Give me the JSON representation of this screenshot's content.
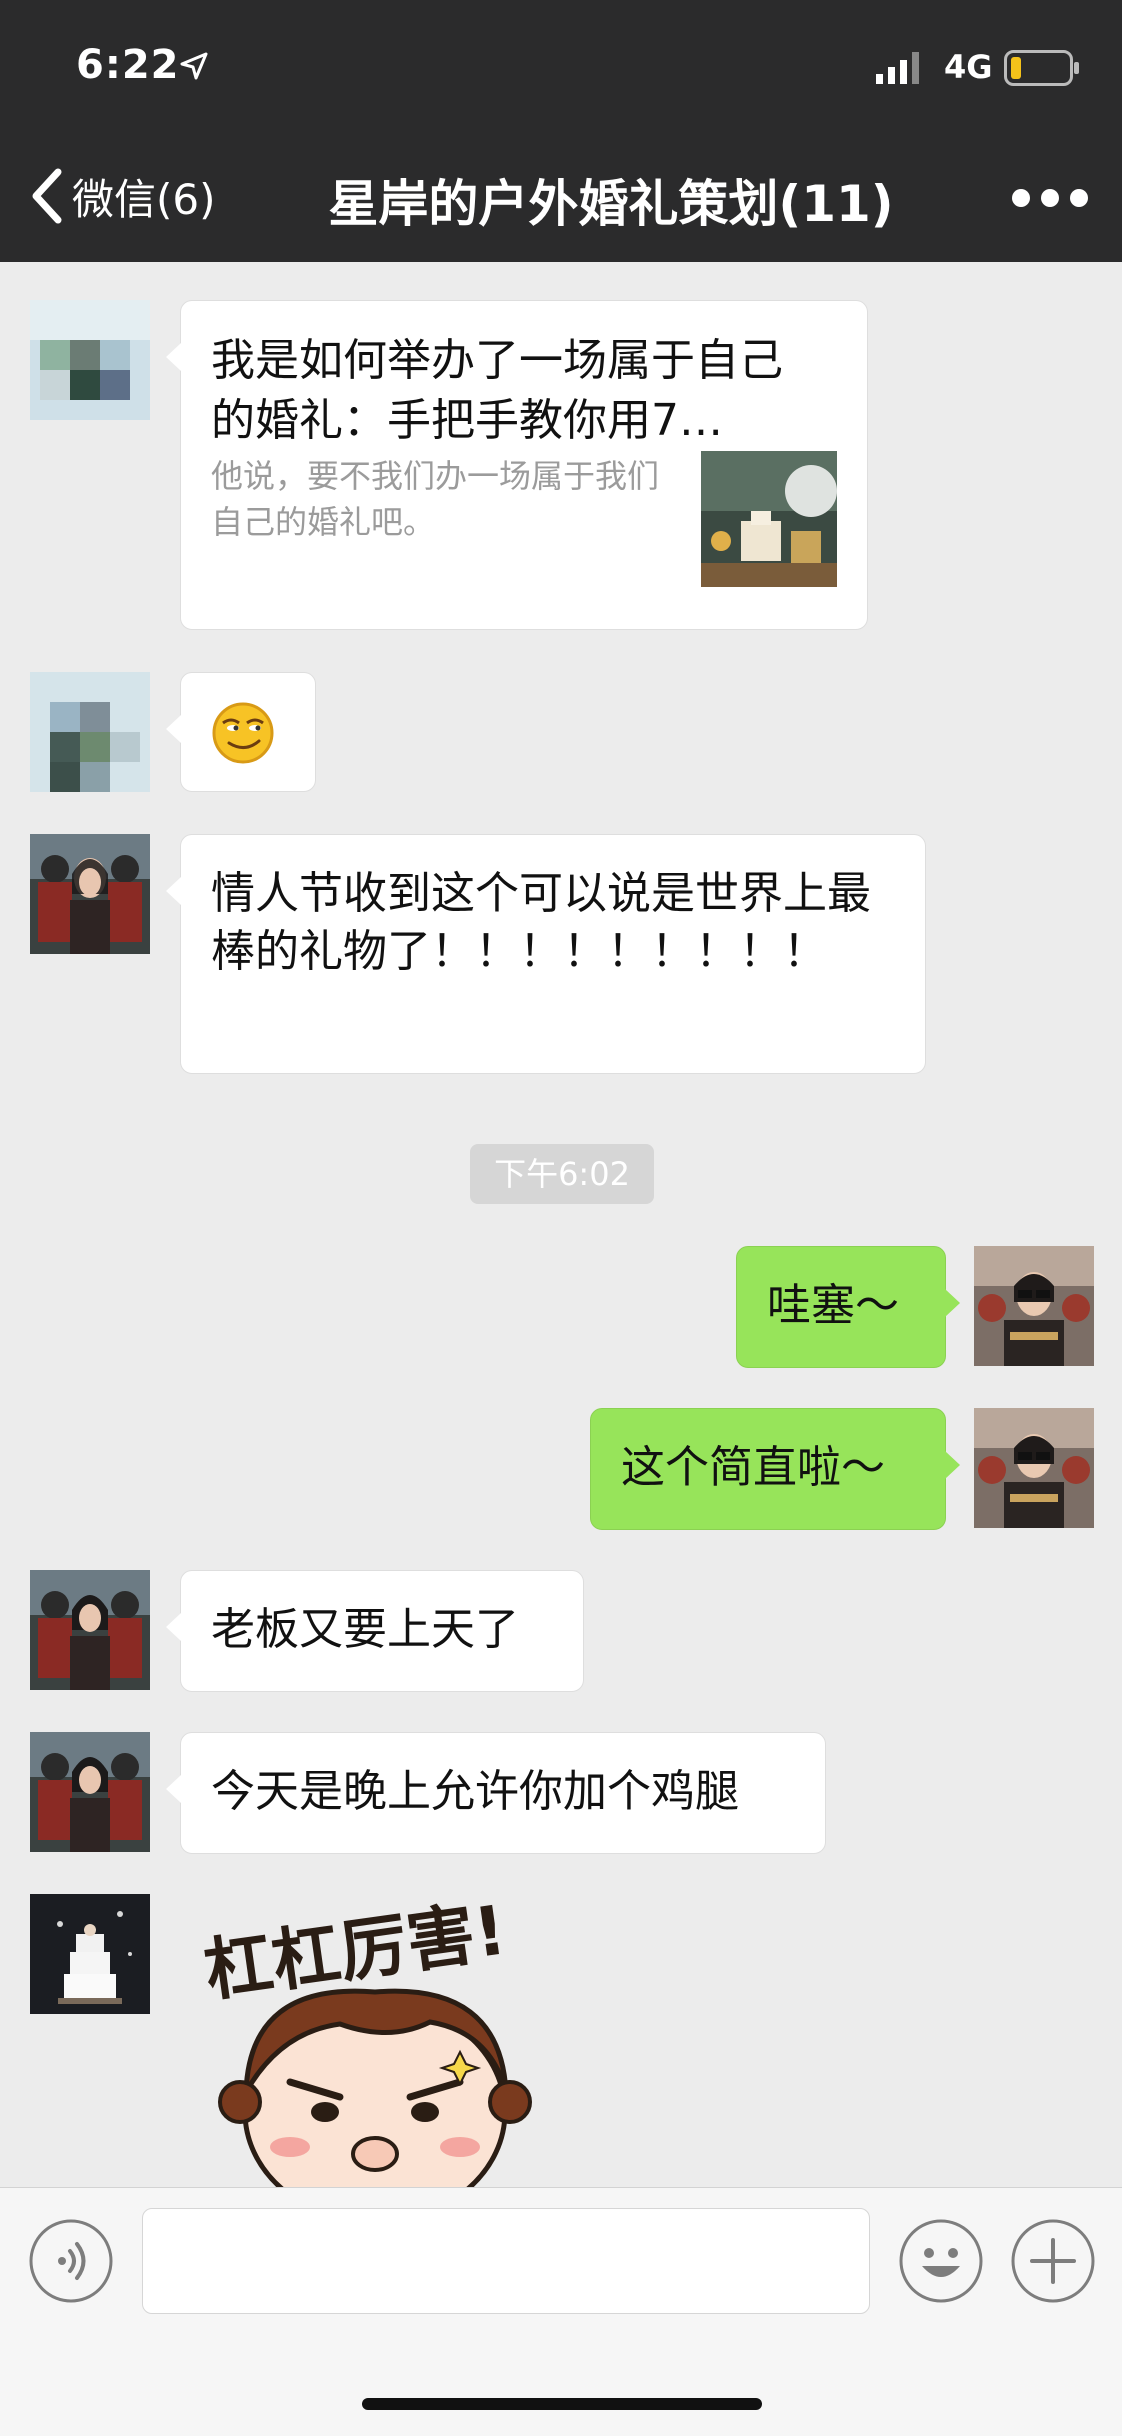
{
  "status_bar": {
    "time": "6:22",
    "network": "4G"
  },
  "nav": {
    "back_label": "微信(6)",
    "title": "星岸的户外婚礼策划(11)"
  },
  "messages": {
    "link_card": {
      "title": "我是如何举办了一场属于自己的婚礼：手把手教你用7…",
      "description": "他说，要不我们办一场属于我们自己的婚礼吧。"
    },
    "emoji_message": "😏",
    "valentine": "情人节收到这个可以说是世界上最棒的礼物了！！！！！！！！！",
    "timestamp": "下午6:02",
    "out_1": "哇塞～",
    "out_2": "这个简直啦～",
    "boss": "老板又要上天了",
    "tonight": "今天是晚上允许你加个鸡腿",
    "sticker_text": "杠杠厉害!"
  },
  "input_bar": {
    "placeholder": ""
  },
  "colors": {
    "header_bg": "#2b2b2c",
    "chat_bg": "#ececec",
    "outgoing_bubble": "#97e45a",
    "incoming_bubble": "#ffffff"
  }
}
